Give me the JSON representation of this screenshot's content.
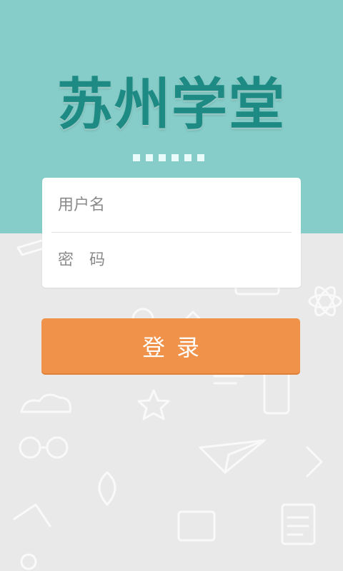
{
  "app": {
    "title": "苏州学堂"
  },
  "login_form": {
    "username_placeholder": "用户名",
    "password_placeholder": "密码",
    "submit_label": "登录"
  },
  "theme": {
    "header_color": "#86ccc8",
    "title_color": "#1e8a84",
    "button_color": "#f0924a",
    "background_color": "#e9e9e9"
  }
}
